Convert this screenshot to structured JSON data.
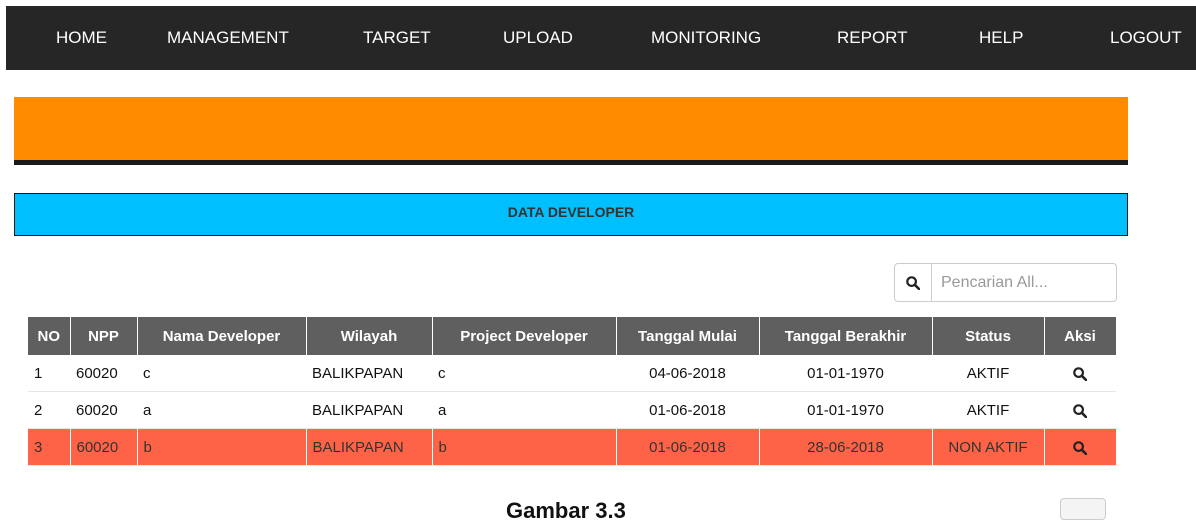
{
  "nav": [
    {
      "label": "HOME"
    },
    {
      "label": "MANAGEMENT"
    },
    {
      "label": "TARGET"
    },
    {
      "label": "UPLOAD"
    },
    {
      "label": "MONITORING"
    },
    {
      "label": "REPORT"
    },
    {
      "label": "HELP"
    },
    {
      "label": "LOGOUT"
    }
  ],
  "colors": {
    "navbar": "#262626",
    "orange": "#ff8c00",
    "title_bar": "#00bfff",
    "table_header": "#5f5f5f",
    "highlight_row": "#ff6347"
  },
  "section_title": "DATA DEVELOPER",
  "search": {
    "placeholder": "Pencarian All...",
    "value": "",
    "icon": "search-icon"
  },
  "table": {
    "headers": [
      "NO",
      "NPP",
      "Nama Developer",
      "Wilayah",
      "Project Developer",
      "Tanggal Mulai",
      "Tanggal Berakhir",
      "Status",
      "Aksi"
    ],
    "rows": [
      {
        "no": "1",
        "npp": "60020",
        "nama": "c",
        "wilayah": "BALIKPAPAN",
        "project": "c",
        "mulai": "04-06-2018",
        "berakhir": "01-01-1970",
        "status": "AKTIF",
        "aksi_icon": "search-icon"
      },
      {
        "no": "2",
        "npp": "60020",
        "nama": "a",
        "wilayah": "BALIKPAPAN",
        "project": "a",
        "mulai": "01-06-2018",
        "berakhir": "01-01-1970",
        "status": "AKTIF",
        "aksi_icon": "search-icon"
      },
      {
        "no": "3",
        "npp": "60020",
        "nama": "b",
        "wilayah": "BALIKPAPAN",
        "project": "b",
        "mulai": "01-06-2018",
        "berakhir": "28-06-2018",
        "status": "NON AKTIF",
        "aksi_icon": "search-icon",
        "highlighted": true
      }
    ]
  },
  "caption": "Gambar 3.3"
}
